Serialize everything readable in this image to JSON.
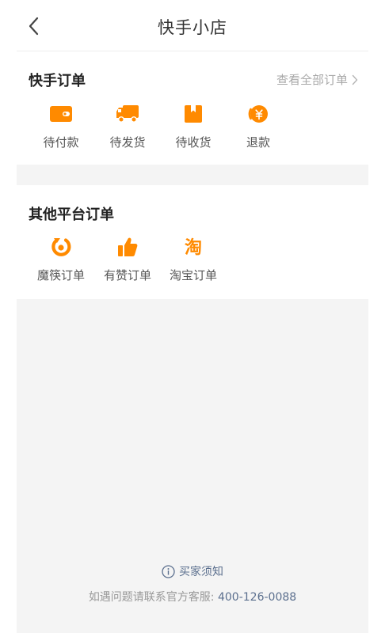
{
  "header": {
    "title": "快手小店"
  },
  "kuaishou_orders": {
    "title": "快手订单",
    "view_all": "查看全部订单",
    "items": [
      {
        "label": "待付款",
        "icon": "wallet-icon"
      },
      {
        "label": "待发货",
        "icon": "truck-icon"
      },
      {
        "label": "待收货",
        "icon": "package-icon"
      },
      {
        "label": "退款",
        "icon": "refund-icon"
      }
    ]
  },
  "other_orders": {
    "title": "其他平台订单",
    "items": [
      {
        "label": "魔筷订单",
        "icon": "mokuai-logo-icon"
      },
      {
        "label": "有赞订单",
        "icon": "youzan-thumbs-up-icon"
      },
      {
        "label": "淘宝订单",
        "icon": "taobao-logo-icon"
      }
    ]
  },
  "footer": {
    "notice": "买家须知",
    "contact_prefix": "如遇问题请联系官方客服: ",
    "phone": "400-126-0088"
  },
  "colors": {
    "accent": "#ff8a00",
    "link": "#5b6f8e",
    "band": "#f4f4f4"
  }
}
